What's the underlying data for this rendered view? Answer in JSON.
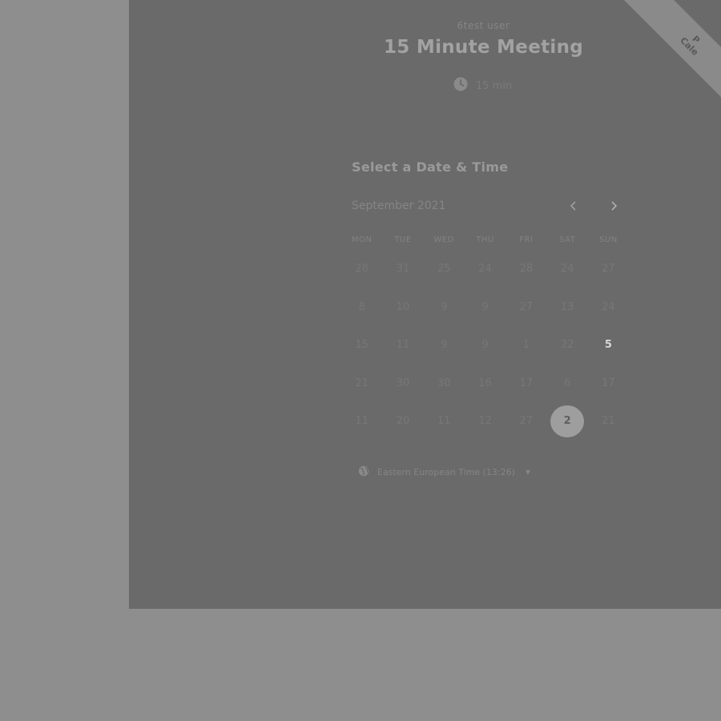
{
  "ribbon": {
    "line1": "P",
    "line2": "Cale"
  },
  "event": {
    "host": "6test user",
    "title": "15 Minute Meeting",
    "duration": "15 min",
    "duration_icon": "clock-icon"
  },
  "picker": {
    "heading": "Select a Date & Time",
    "month": "September 2021",
    "prev_icon": "chevron-left-icon",
    "next_icon": "chevron-right-icon",
    "weekdays": [
      "MON",
      "TUE",
      "WED",
      "THU",
      "FRI",
      "SAT",
      "SUN"
    ],
    "rows": [
      [
        "28",
        "31",
        "25",
        "24",
        "28",
        "24",
        "27"
      ],
      [
        "8",
        "10",
        "9",
        "9",
        "27",
        "13",
        "24"
      ],
      [
        "15",
        "11",
        "9",
        "9",
        "1",
        "22",
        "5"
      ],
      [
        "21",
        "30",
        "30",
        "16",
        "17",
        "6",
        "17"
      ],
      [
        "11",
        "20",
        "11",
        "12",
        "27",
        "2",
        "21"
      ]
    ],
    "available_day": "5",
    "selected_day": "2"
  },
  "timezone": {
    "icon": "globe-icon",
    "label": "Eastern European Time (13:26)"
  },
  "colors": {
    "backdrop": "#8e8e8e",
    "panel": "#6a6a6a",
    "selected_circle": "#9e9e9e"
  }
}
